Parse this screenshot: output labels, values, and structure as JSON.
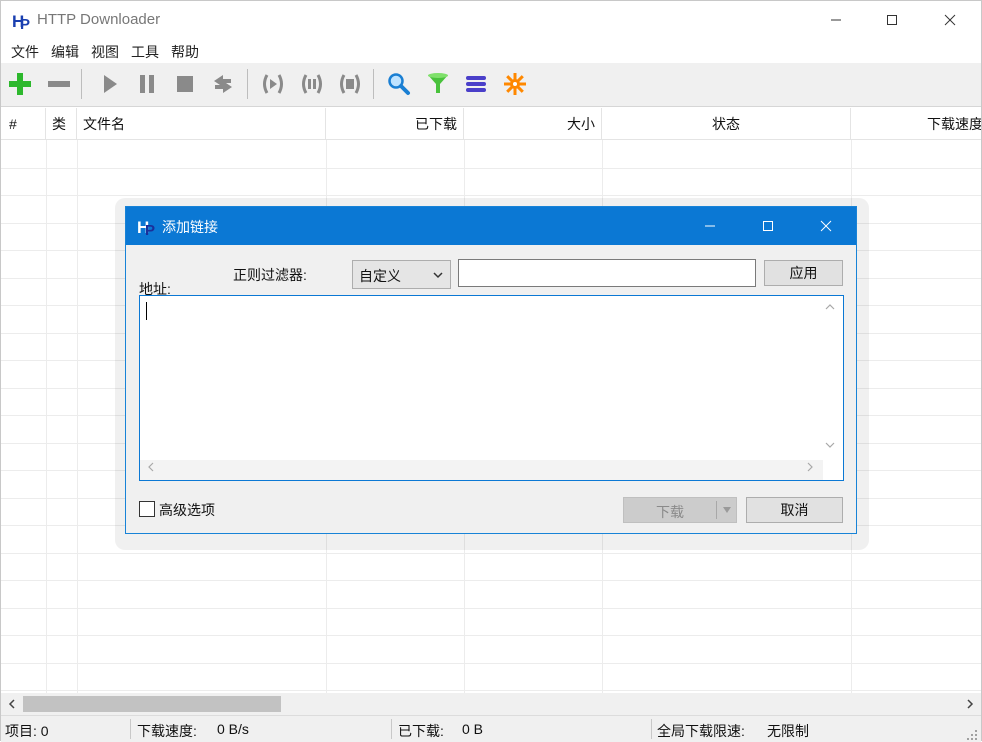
{
  "window": {
    "title": "HTTP Downloader"
  },
  "menu": [
    "文件",
    "编辑",
    "视图",
    "工具",
    "帮助"
  ],
  "toolbar": {
    "icons": [
      "add-icon",
      "remove-icon",
      "start-icon",
      "pause-icon",
      "stop-icon",
      "restart-icon",
      "start-all-icon",
      "pause-all-icon",
      "stop-all-icon",
      "search-icon",
      "filter-icon",
      "list-icon",
      "options-icon"
    ],
    "accent_green": "#2db82d",
    "accent_blue": "#1a7fd3",
    "accent_orange": "#ff8800"
  },
  "table": {
    "columns": [
      "#",
      "类",
      "文件名",
      "已下载",
      "大小",
      "状态",
      "下载速度"
    ]
  },
  "dialog": {
    "title": "添加链接",
    "filter_label": "正则过滤器:",
    "filter_selected": "自定义",
    "filter_value": "",
    "apply_label": "应用",
    "url_label": "地址:",
    "url_value": "",
    "advanced_label": "高级选项",
    "advanced_checked": false,
    "download_label": "下载",
    "cancel_label": "取消"
  },
  "status": {
    "items_label": "项目: 0",
    "speed_label": "下载速度:",
    "speed_value": "0 B/s",
    "downloaded_label": "已下载:",
    "downloaded_value": "0 B",
    "limit_label": "全局下载限速:",
    "limit_value": "无限制"
  },
  "colors": {
    "title_blue": "#0b78d4",
    "bar_bg": "#f0f0f0"
  }
}
